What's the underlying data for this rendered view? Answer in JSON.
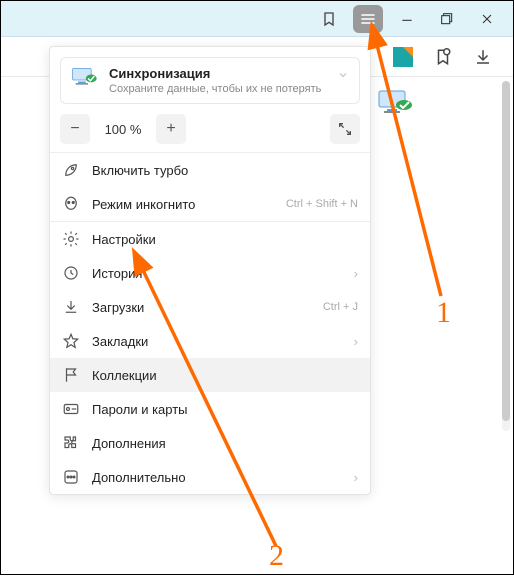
{
  "titlebar": {
    "bookmark_icon": "bookmark",
    "menu_icon": "menu",
    "minimize": "minimize",
    "maximize": "maximize",
    "close": "close"
  },
  "toolbar2": {
    "tab_icon": "yandex-tab",
    "panel_icon": "side-panel",
    "download_icon": "downloads"
  },
  "sync": {
    "title": "Синхронизация",
    "subtitle": "Сохраните данные, чтобы их не потерять"
  },
  "zoom": {
    "minus": "−",
    "value": "100 %",
    "plus": "+"
  },
  "menu": {
    "turbo": "Включить турбо",
    "incognito": "Режим инкогнито",
    "incognito_shortcut": "Ctrl + Shift + N",
    "settings": "Настройки",
    "history": "История",
    "downloads": "Загрузки",
    "downloads_shortcut": "Ctrl + J",
    "bookmarks": "Закладки",
    "collections": "Коллекции",
    "passwords": "Пароли и карты",
    "addons": "Дополнения",
    "more": "Дополнительно"
  },
  "annotations": {
    "label1": "1",
    "label2": "2"
  }
}
